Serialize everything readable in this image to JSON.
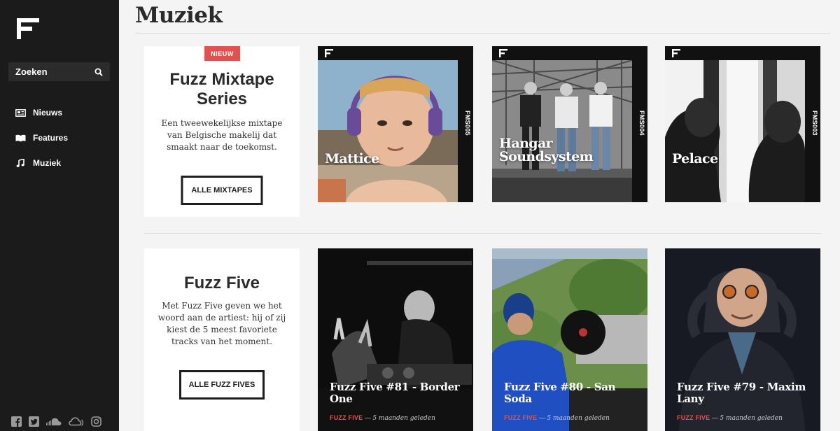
{
  "sidebar": {
    "search_label": "Zoeken",
    "items": [
      {
        "label": "Nieuws",
        "icon": "newspaper-icon"
      },
      {
        "label": "Features",
        "icon": "book-icon"
      },
      {
        "label": "Muziek",
        "icon": "music-note-icon"
      }
    ],
    "social": [
      "facebook-icon",
      "twitter-icon",
      "soundcloud-icon",
      "mixcloud-icon",
      "instagram-icon"
    ]
  },
  "page": {
    "title": "Muziek"
  },
  "mixtapes": {
    "badge": "NIEUW",
    "title": "Fuzz Mixtape Series",
    "description": "Een tweewekelijkse mixtape van Belgische makelij dat smaakt naar de toekomst.",
    "button": "ALLE MIXTAPES",
    "cards": [
      {
        "title": "Mattice",
        "code": "FMS005"
      },
      {
        "title": "Hangar Soundsystem",
        "code": "FMS004"
      },
      {
        "title": "Pelace",
        "code": "FMS003"
      }
    ]
  },
  "fuzzfive": {
    "title": "Fuzz Five",
    "description": "Met Fuzz Five geven we het woord aan de artiest: hij of zij kiest de 5 meest favoriete tracks van het moment.",
    "button": "ALLE FUZZ FIVES",
    "cards": [
      {
        "title": "Fuzz Five #81 - Border One",
        "category": "FUZZ FIVE",
        "separator": "—",
        "date": "5 maanden geleden"
      },
      {
        "title": "Fuzz Five #80 - San Soda",
        "category": "FUZZ FIVE",
        "separator": "—",
        "date": "5 maanden geleden"
      },
      {
        "title": "Fuzz Five #79 - Maxim Lany",
        "category": "FUZZ FIVE",
        "separator": "—",
        "date": "5 maanden geleden"
      }
    ]
  },
  "colors": {
    "sidebar_bg": "#1b1b1b",
    "accent": "#e05252",
    "page_bg": "#f4f4f4"
  }
}
